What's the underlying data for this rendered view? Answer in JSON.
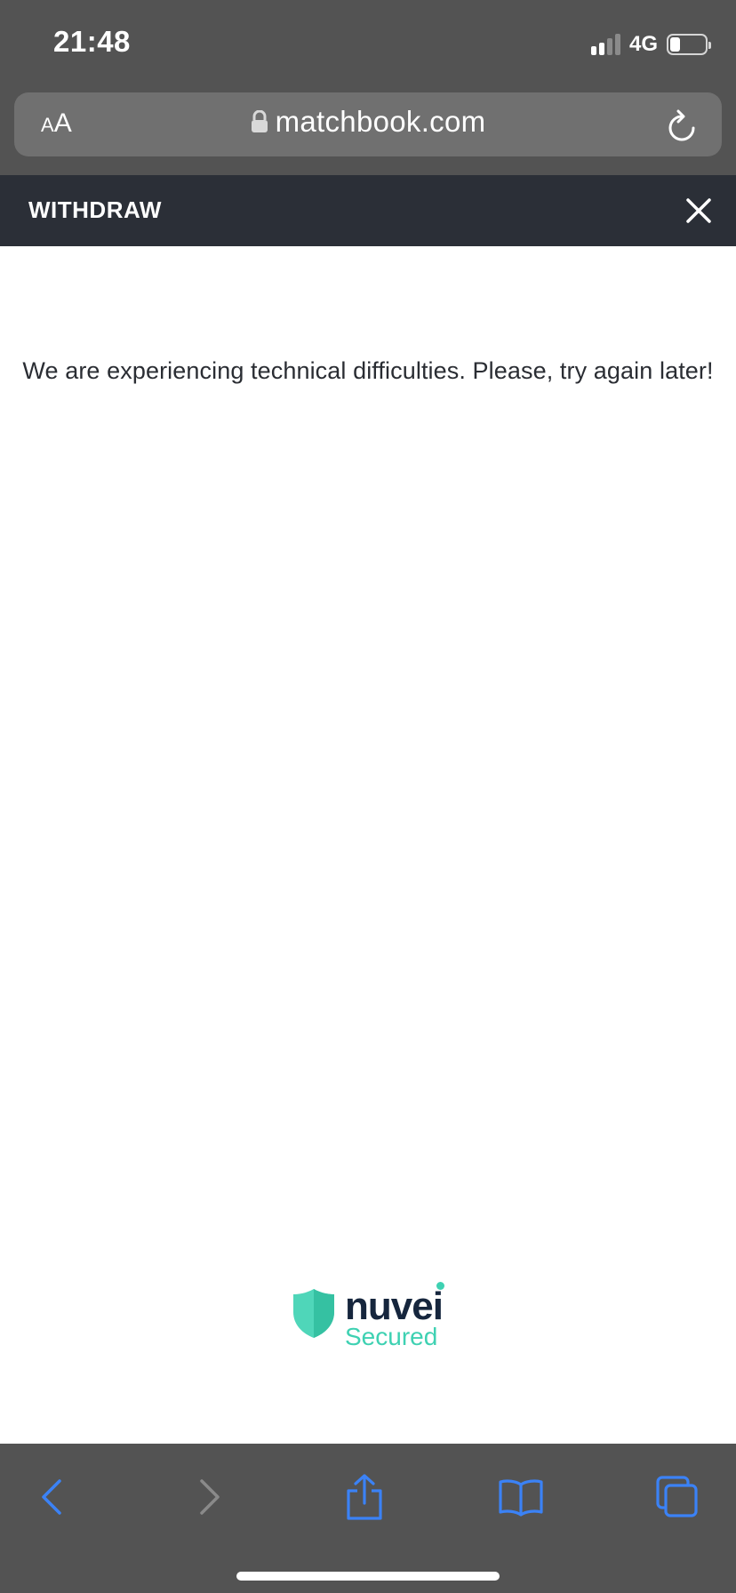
{
  "status_bar": {
    "time": "21:48",
    "network": "4G",
    "signal_bars_active": 2,
    "signal_bars_total": 4,
    "battery_level": 0.3
  },
  "browser": {
    "text_size_small": "A",
    "text_size_large": "A",
    "url": "matchbook.com"
  },
  "header": {
    "title": "WITHDRAW"
  },
  "main": {
    "message": "We are experiencing technical difficulties. Please, try again later!"
  },
  "logo": {
    "brand": "nuvei",
    "tagline": "Secured"
  },
  "colors": {
    "chrome_bg": "#535353",
    "header_bg": "#2b2f37",
    "accent_blue": "#3b82f6",
    "brand_teal": "#3ed1b2",
    "brand_navy": "#16263d",
    "disabled_gray": "#8a8a8a"
  },
  "icons": {
    "lock": "lock-icon",
    "reload": "reload-icon",
    "close": "close-icon",
    "back": "chevron-left-icon",
    "forward": "chevron-right-icon",
    "share": "share-icon",
    "bookmarks": "book-icon",
    "tabs": "tabs-icon",
    "shield": "shield-icon"
  }
}
